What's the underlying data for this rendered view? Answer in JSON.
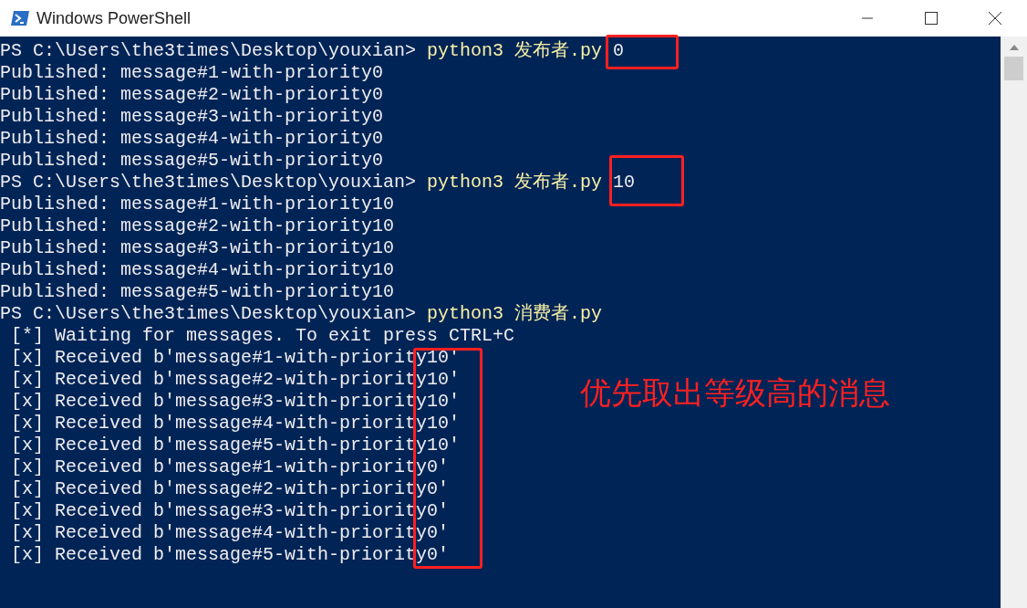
{
  "window": {
    "title": "Windows PowerShell"
  },
  "console": {
    "lines": [
      {
        "kind": "prompt",
        "prompt": "PS C:\\Users\\the3times\\Desktop\\youxian> ",
        "command": "python3 发布者.py",
        "args": " 0"
      },
      {
        "kind": "output",
        "text": "Published: message#1-with-priority0"
      },
      {
        "kind": "output",
        "text": "Published: message#2-with-priority0"
      },
      {
        "kind": "output",
        "text": "Published: message#3-with-priority0"
      },
      {
        "kind": "output",
        "text": "Published: message#4-with-priority0"
      },
      {
        "kind": "output",
        "text": "Published: message#5-with-priority0"
      },
      {
        "kind": "prompt",
        "prompt": "PS C:\\Users\\the3times\\Desktop\\youxian> ",
        "command": "python3 发布者.py",
        "args": " 10"
      },
      {
        "kind": "output",
        "text": "Published: message#1-with-priority10"
      },
      {
        "kind": "output",
        "text": "Published: message#2-with-priority10"
      },
      {
        "kind": "output",
        "text": "Published: message#3-with-priority10"
      },
      {
        "kind": "output",
        "text": "Published: message#4-with-priority10"
      },
      {
        "kind": "output",
        "text": "Published: message#5-with-priority10"
      },
      {
        "kind": "prompt",
        "prompt": "PS C:\\Users\\the3times\\Desktop\\youxian> ",
        "command": "python3 消费者.py"
      },
      {
        "kind": "output",
        "text": " [*] Waiting for messages. To exit press CTRL+C"
      },
      {
        "kind": "output",
        "text": " [x] Received b'message#1-with-priority10'"
      },
      {
        "kind": "output",
        "text": " [x] Received b'message#2-with-priority10'"
      },
      {
        "kind": "output",
        "text": " [x] Received b'message#3-with-priority10'"
      },
      {
        "kind": "output",
        "text": " [x] Received b'message#4-with-priority10'"
      },
      {
        "kind": "output",
        "text": " [x] Received b'message#5-with-priority10'"
      },
      {
        "kind": "output",
        "text": " [x] Received b'message#1-with-priority0'"
      },
      {
        "kind": "output",
        "text": " [x] Received b'message#2-with-priority0'"
      },
      {
        "kind": "output",
        "text": " [x] Received b'message#3-with-priority0'"
      },
      {
        "kind": "output",
        "text": " [x] Received b'message#4-with-priority0'"
      },
      {
        "kind": "output",
        "text": " [x] Received b'message#5-with-priority0'"
      }
    ]
  },
  "annotation": {
    "text": "优先取出等级高的消息"
  }
}
